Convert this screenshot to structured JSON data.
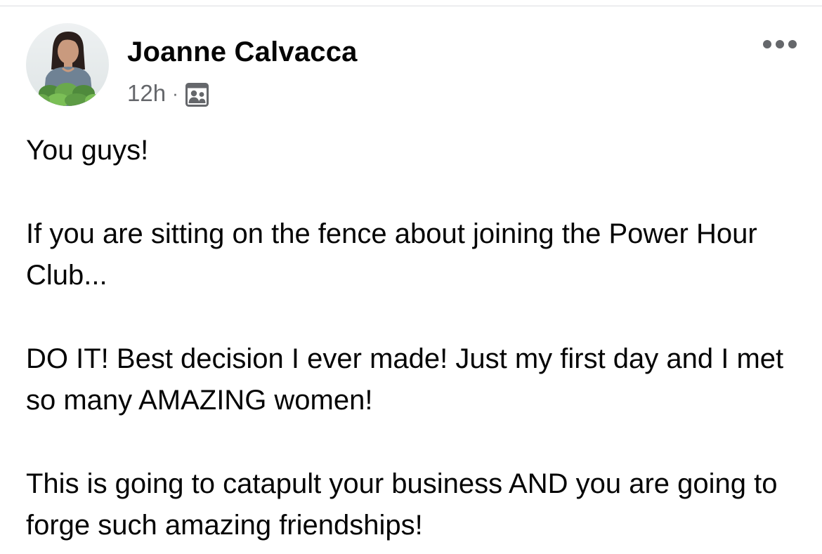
{
  "post": {
    "author": "Joanne Calvacca",
    "timestamp": "12h",
    "separator": "·",
    "audience_icon": "group-members-icon",
    "more_icon": "more-options-icon",
    "paragraphs": [
      "You guys!",
      "If you are sitting on the fence about joining the Power Hour Club...",
      "DO IT!  Best decision I ever made! Just my first day and I met so many AMAZING women!",
      "This is going to catapult your business AND you are going to forge such amazing friendships!"
    ]
  },
  "colors": {
    "text_primary": "#050505",
    "text_secondary": "#65676b",
    "divider": "#dcdde1"
  }
}
